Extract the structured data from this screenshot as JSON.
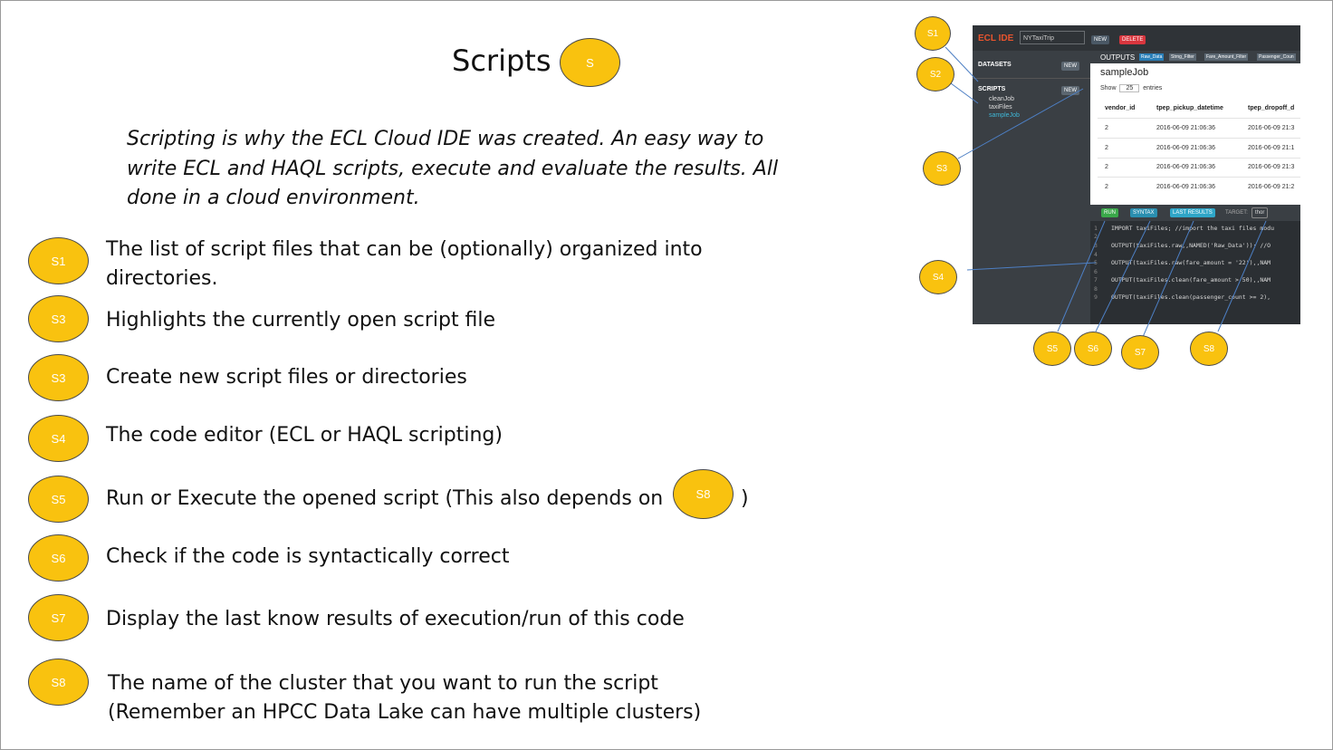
{
  "slide": {
    "title": "Scripts",
    "title_badge": "S",
    "intro": "Scripting is why the ECL Cloud IDE was created. An easy way to write ECL and HAQL scripts, execute and evaluate the results. All done in a cloud environment.",
    "badge_color": "#f9c20f"
  },
  "items": [
    {
      "badge": "S1",
      "text": "The list of script files that can be (optionally) organized into directories."
    },
    {
      "badge": "S3",
      "text": "Highlights the currently open script file"
    },
    {
      "badge": "S3",
      "text": "Create new script files or directories"
    },
    {
      "badge": "S4",
      "text": "The code editor (ECL or HAQL scripting)"
    },
    {
      "badge": "S5",
      "text": "Run or Execute the opened script (This also depends on",
      "suffix": ")",
      "inline_badge": "S8"
    },
    {
      "badge": "S6",
      "text": "Check if the code is syntactically correct"
    },
    {
      "badge": "S7",
      "text": "Display the last know results of execution/run of this code"
    },
    {
      "badge": "S8",
      "text": "The name of the cluster that you want to run the script (Remember an HPCC Data Lake can have multiple clusters)"
    }
  ],
  "callouts": [
    "S1",
    "S2",
    "S3",
    "S4",
    "S5",
    "S6",
    "S7",
    "S8"
  ],
  "ide": {
    "brand": "ECL IDE",
    "workspace": "NYTaxiTrip",
    "new_label": "NEW",
    "delete_label": "DELETE",
    "datasets_label": "DATASETS",
    "scripts_label": "SCRIPTS",
    "files": [
      "cleanJob",
      "taxiFiles",
      "sampleJob"
    ],
    "outputs_label": "OUTPUTS",
    "output_tabs": [
      "Raw_Data",
      "Strng_Filter",
      "Fare_Amount_Filter",
      "Passenger_Coun"
    ],
    "job_name": "sampleJob",
    "show_label": "Show",
    "show_value": "25",
    "entries_label": "entries",
    "columns": [
      "vendor_id",
      "tpep_pickup_datetime",
      "tpep_dropoff_d"
    ],
    "rows": [
      [
        "2",
        "2016-06-09 21:06:36",
        "2016-06-09 21:3"
      ],
      [
        "2",
        "2016-06-09 21:06:36",
        "2016-06-09 21:1"
      ],
      [
        "2",
        "2016-06-09 21:06:36",
        "2016-06-09 21:3"
      ],
      [
        "2",
        "2016-06-09 21:06:36",
        "2016-06-09 21:2"
      ]
    ],
    "run_label": "RUN",
    "syntax_label": "SYNTAX",
    "last_results_label": "LAST RESULTS",
    "target_label": "TARGET:",
    "target_value": "thor",
    "code_lines": [
      "IMPORT taxiFiles; //import the taxi files modu",
      "",
      "OUTPUT(taxiFiles.raw,,NAMED('Raw_Data')); //O",
      "",
      "OUTPUT(taxiFiles.raw(fare_amount = '22'),,NAM",
      "",
      "OUTPUT(taxiFiles.clean(fare_amount > 50),,NAM",
      "",
      "OUTPUT(taxiFiles.clean(passenger_count >= 2),"
    ]
  }
}
